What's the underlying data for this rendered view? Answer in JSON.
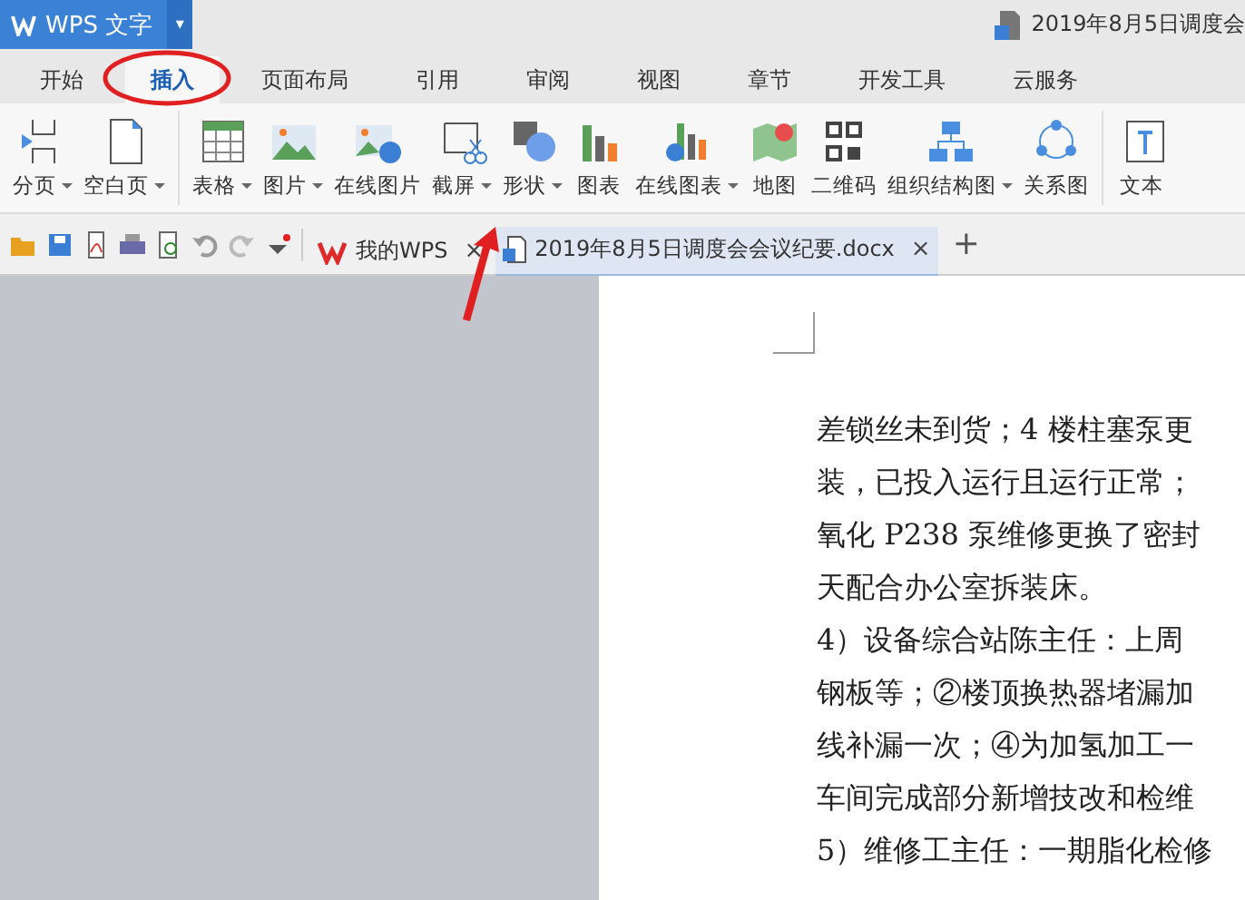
{
  "app_button": {
    "label": "WPS 文字",
    "menu_caret": "▾"
  },
  "window": {
    "title": "2019年8月5日调度会"
  },
  "tabs": [
    {
      "label": "开始",
      "selected": false
    },
    {
      "label": "插入",
      "selected": true
    },
    {
      "label": "页面布局",
      "selected": false
    },
    {
      "label": "引用",
      "selected": false
    },
    {
      "label": "审阅",
      "selected": false
    },
    {
      "label": "视图",
      "selected": false
    },
    {
      "label": "章节",
      "selected": false
    },
    {
      "label": "开发工具",
      "selected": false
    },
    {
      "label": "云服务",
      "selected": false
    }
  ],
  "ribbon_groups": [
    {
      "items": [
        {
          "label": "分页",
          "kind": "pagebreak",
          "dropdown": true
        },
        {
          "label": "空白页",
          "kind": "blankpage",
          "dropdown": true
        }
      ]
    },
    {
      "items": [
        {
          "label": "表格",
          "kind": "table",
          "dropdown": true
        },
        {
          "label": "图片",
          "kind": "picture",
          "dropdown": true
        },
        {
          "label": "在线图片",
          "kind": "onlinepicture",
          "dropdown": false
        },
        {
          "label": "截屏",
          "kind": "screenshot",
          "dropdown": true
        },
        {
          "label": "形状",
          "kind": "shapes",
          "dropdown": true
        },
        {
          "label": "图表",
          "kind": "chart",
          "dropdown": false
        },
        {
          "label": "在线图表",
          "kind": "onlinechart",
          "dropdown": true
        },
        {
          "label": "地图",
          "kind": "map",
          "dropdown": false
        },
        {
          "label": "二维码",
          "kind": "qrcode",
          "dropdown": false
        },
        {
          "label": "组织结构图",
          "kind": "orgchart",
          "dropdown": true
        },
        {
          "label": "关系图",
          "kind": "relation",
          "dropdown": false
        }
      ]
    },
    {
      "items": [
        {
          "label": "文本",
          "kind": "textbox",
          "dropdown": false
        }
      ]
    }
  ],
  "quick_toolbar": [
    {
      "kind": "open"
    },
    {
      "kind": "save"
    },
    {
      "kind": "pdf"
    },
    {
      "kind": "print"
    },
    {
      "kind": "preview"
    },
    {
      "kind": "undo"
    },
    {
      "kind": "redo"
    },
    {
      "kind": "customize"
    }
  ],
  "doc_tabs": [
    {
      "label": "我的WPS",
      "kind": "home",
      "selected": false,
      "close": "×"
    },
    {
      "label": "2019年8月5日调度会会议纪要.docx",
      "kind": "doc",
      "selected": true,
      "close": "×"
    }
  ],
  "new_tab": "+",
  "document": {
    "lines": [
      "差锁丝未到货；4 楼柱塞泵更",
      "装，已投入运行且运行正常；",
      "氧化 P238 泵维修更换了密封",
      "天配合办公室拆装床。",
      "4）设备综合站陈主任：上周",
      "钢板等；②楼顶换热器堵漏加",
      "线补漏一次；④为加氢加工一",
      "车间完成部分新增技改和检维",
      "5）维修工主任：一期脂化检修"
    ]
  }
}
